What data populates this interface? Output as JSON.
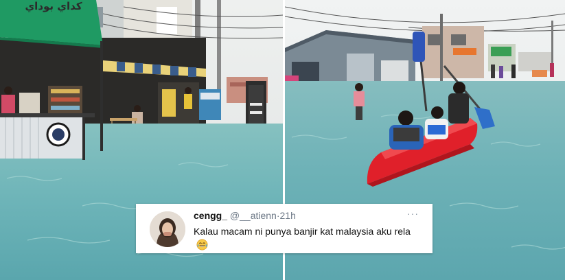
{
  "left_photo": {
    "stall_sign": "كداي بوداي",
    "stall_logo": "circular stall logo"
  },
  "tweet": {
    "display_name": "cengg_",
    "handle": "@__atienn",
    "separator": "·",
    "time": "21h",
    "more_icon": "···",
    "text": "Kalau macam ni punya banjir kat malaysia aku rela",
    "emoji": "face-with-tears-of-joy"
  },
  "colors": {
    "flood_water": "#6fb7b9",
    "kayak_red": "#e0202a",
    "awning_green": "#1f9a63",
    "tweet_bg": "#ffffff",
    "muted_text": "#6b7785"
  }
}
